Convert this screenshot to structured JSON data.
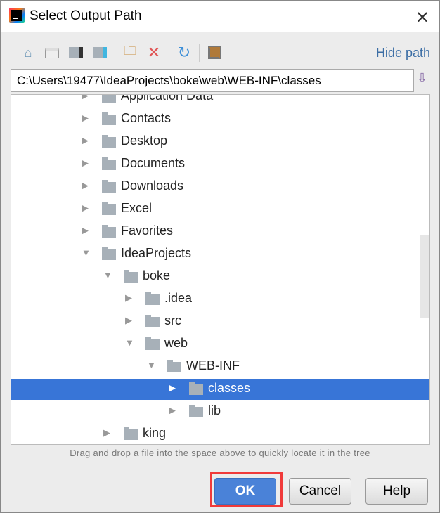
{
  "window": {
    "title": "Select Output Path",
    "close_icon": "close-icon"
  },
  "toolbar": {
    "icons": [
      "home-icon",
      "desktop-icon",
      "project-folder-icon",
      "module-folder-icon",
      "new-folder-icon",
      "delete-icon",
      "refresh-icon",
      "show-hidden-icon"
    ],
    "hide_path": "Hide path"
  },
  "path": {
    "value": "C:\\Users\\19477\\IdeaProjects\\boke\\web\\WEB-INF\\classes"
  },
  "tree": {
    "items": [
      {
        "label": "Application Data",
        "level": 0,
        "expanded": false
      },
      {
        "label": "Contacts",
        "level": 0,
        "expanded": false
      },
      {
        "label": "Desktop",
        "level": 0,
        "expanded": false
      },
      {
        "label": "Documents",
        "level": 0,
        "expanded": false
      },
      {
        "label": "Downloads",
        "level": 0,
        "expanded": false
      },
      {
        "label": "Excel",
        "level": 0,
        "expanded": false
      },
      {
        "label": "Favorites",
        "level": 0,
        "expanded": false
      },
      {
        "label": "IdeaProjects",
        "level": 0,
        "expanded": true
      },
      {
        "label": "boke",
        "level": 1,
        "expanded": true
      },
      {
        "label": ".idea",
        "level": 2,
        "expanded": false
      },
      {
        "label": "src",
        "level": 2,
        "expanded": false
      },
      {
        "label": "web",
        "level": 2,
        "expanded": true
      },
      {
        "label": "WEB-INF",
        "level": 3,
        "expanded": true
      },
      {
        "label": "classes",
        "level": 4,
        "expanded": false,
        "selected": true
      },
      {
        "label": "lib",
        "level": 4,
        "expanded": false
      },
      {
        "label": "king",
        "level": 1,
        "expanded": false
      }
    ]
  },
  "hint": "Drag and drop a file into the space above to quickly locate it in the tree",
  "buttons": {
    "ok": "OK",
    "cancel": "Cancel",
    "help": "Help"
  },
  "colors": {
    "selection": "#3875d7",
    "link": "#3c6ea5",
    "highlight": "#f03a3a"
  }
}
